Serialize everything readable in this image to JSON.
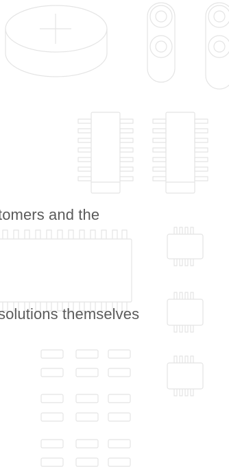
{
  "text_fragments": [
    "tomers and the",
    "solutions themselves"
  ],
  "icons": {
    "coin_battery": "coin-battery-icon",
    "inductor": "inductor-icon",
    "ic_chip": "ic-chip-icon",
    "smd_component": "smd-component-icon",
    "pad_grid": "pad-grid-icon"
  },
  "colors": {
    "background": "#ffffff",
    "line_art": "#e4e4e4",
    "text": "#5a5a5a"
  }
}
